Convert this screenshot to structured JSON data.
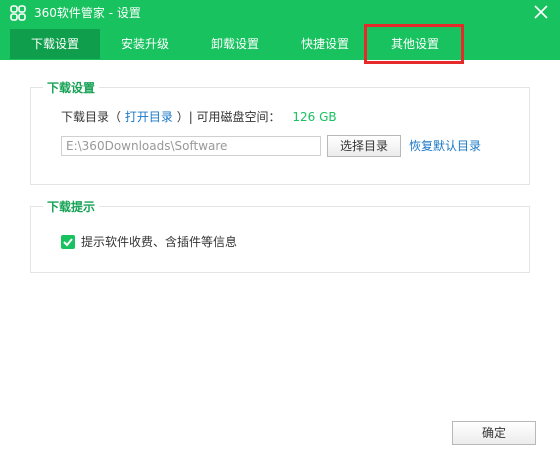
{
  "window": {
    "title": "360软件管家 - 设置",
    "colors": {
      "accent": "#17c25f",
      "tab_active": "#0f9f4c",
      "link": "#1a78c8",
      "highlight": "#e62a2a"
    }
  },
  "tabs": [
    {
      "label": "下载设置",
      "active": true
    },
    {
      "label": "安装升级",
      "active": false
    },
    {
      "label": "卸载设置",
      "active": false
    },
    {
      "label": "快捷设置",
      "active": false
    },
    {
      "label": "其他设置",
      "active": false
    }
  ],
  "download_settings": {
    "group_title": "下载设置",
    "dir_label": "下载目录（",
    "open_dir_link": "打开目录",
    "dir_label_end": "）| 可用磁盘空间：",
    "free_space": "126 GB",
    "path_value": "E:\\360Downloads\\Software",
    "choose_dir_button": "选择目录",
    "restore_default_link": "恢复默认目录"
  },
  "download_tips": {
    "group_title": "下载提示",
    "checkbox_label": "提示软件收费、含插件等信息",
    "checked": true
  },
  "footer": {
    "ok_button": "确定"
  }
}
